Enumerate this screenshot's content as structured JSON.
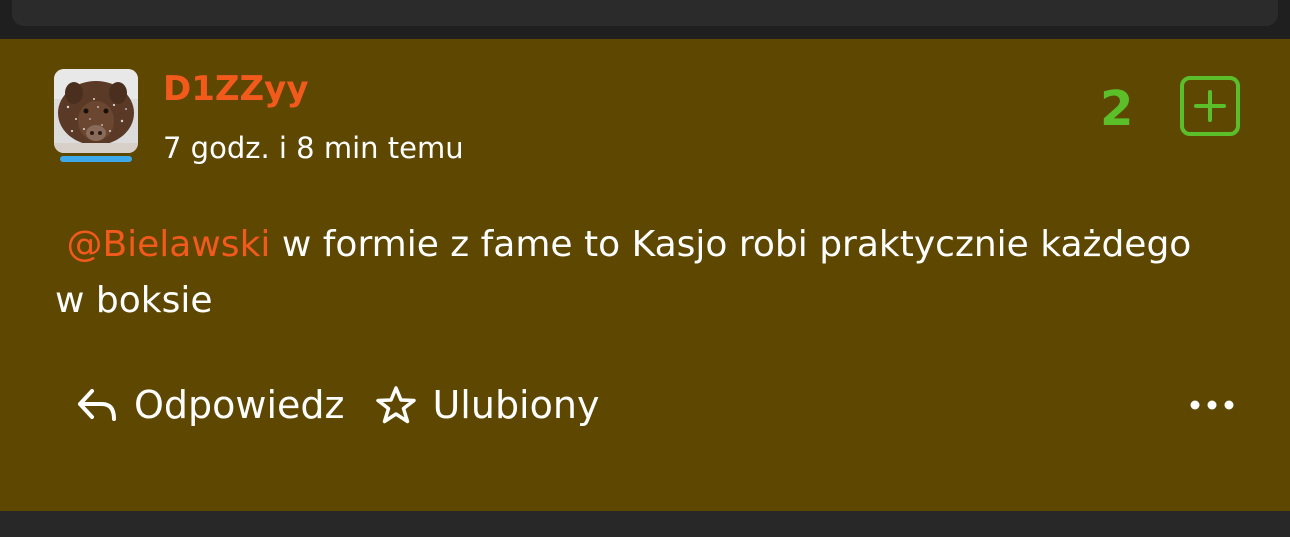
{
  "comment": {
    "author": "D1ZZyy",
    "timestamp": "7 godz. i 8 min temu",
    "votes": "2",
    "mention": "@Bielawski",
    "text_rest": " w formie z fame to Kasjo robi praktycznie każdego w boksie"
  },
  "actions": {
    "reply_label": "Odpowiedz",
    "favorite_label": "Ulubiony"
  },
  "icons": {
    "reply": "reply-arrow-icon",
    "favorite": "star-outline-icon",
    "upvote": "plus-square-icon",
    "more": "more-dots-icon"
  },
  "colors": {
    "comment_background": "#5e4700",
    "author": "#f25a1c",
    "mention": "#f25a1c",
    "votes": "#5bbf2a",
    "avatar_bar": "#3ea9e8"
  }
}
